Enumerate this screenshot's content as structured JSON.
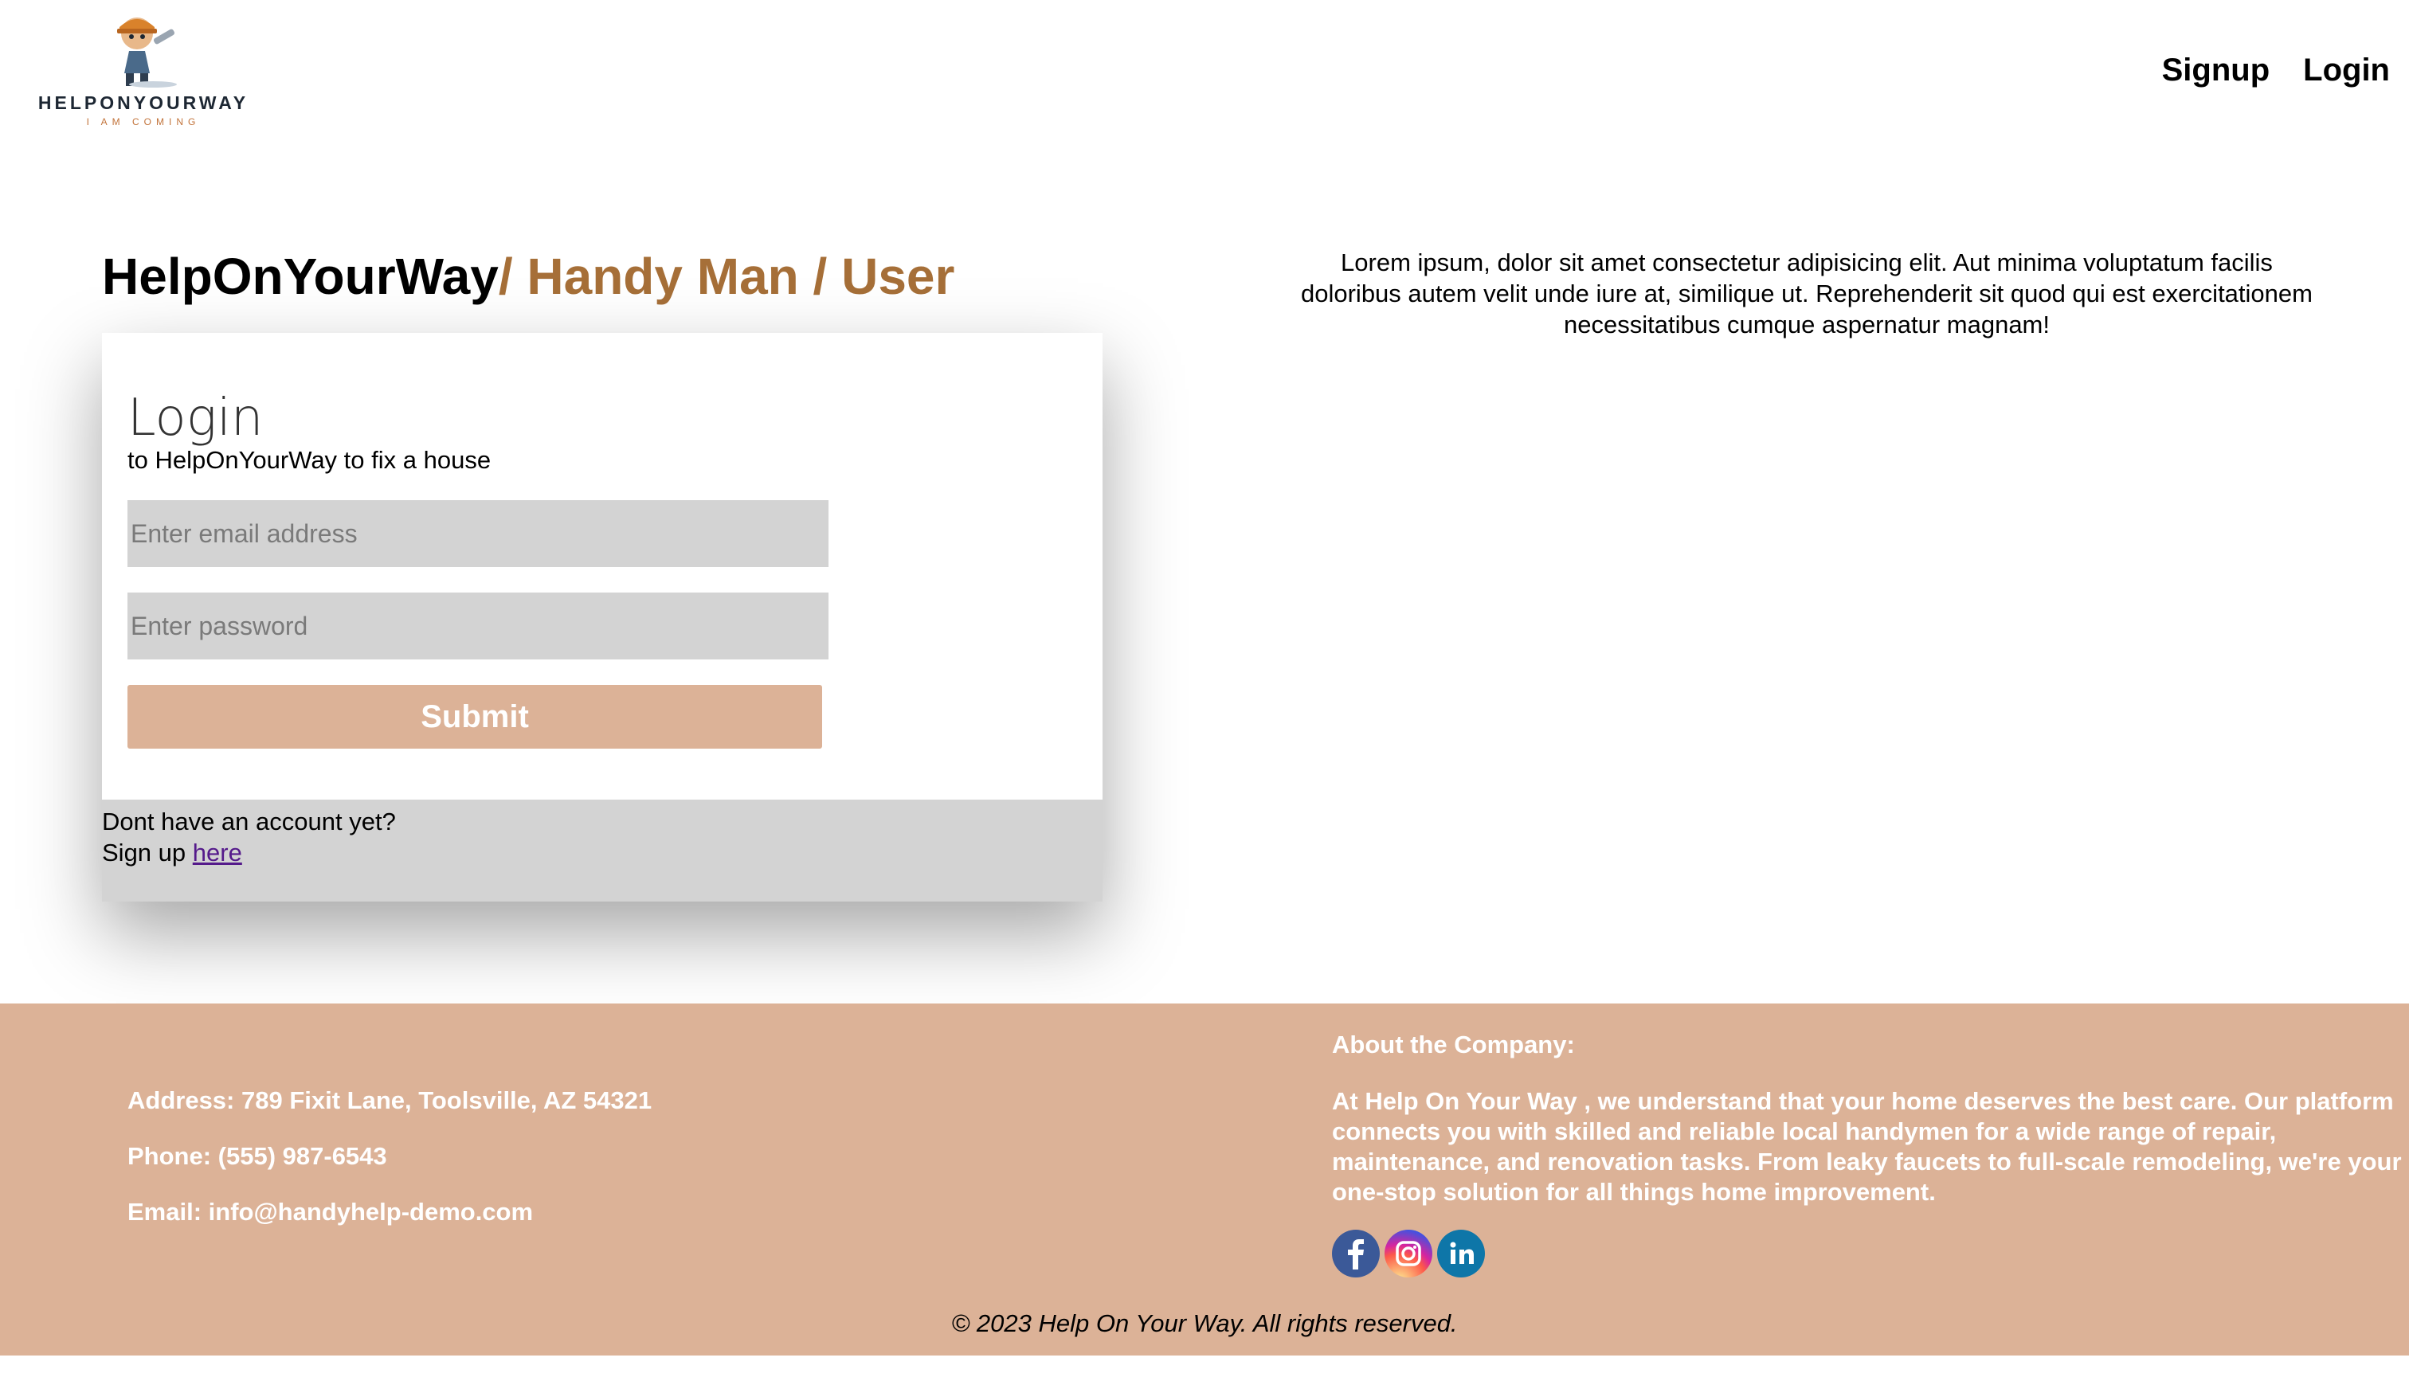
{
  "header": {
    "logo_name": "HELPONYOURWAY",
    "logo_tagline": "I AM COMING",
    "nav": {
      "signup": "Signup",
      "login": "Login"
    }
  },
  "breadcrumb": {
    "brand": "HelpOnYourWay",
    "path": "/ Handy Man / User"
  },
  "login_form": {
    "title": "Login",
    "subtitle": "to HelpOnYourWay to fix a house",
    "email_placeholder": "Enter email address",
    "password_placeholder": "Enter password",
    "submit_label": "Submit",
    "no_account_text": "Dont have an account yet?",
    "signup_prefix": "Sign up ",
    "signup_link": "here"
  },
  "intro_text": "Lorem ipsum, dolor sit amet consectetur adipisicing elit. Aut minima voluptatum facilis doloribus autem velit unde iure at, similique ut. Reprehenderit sit quod qui est exercitationem necessitatibus cumque aspernatur magnam!",
  "footer": {
    "address": "Address: 789 Fixit Lane, Toolsville, AZ 54321",
    "phone": "Phone: (555) 987-6543",
    "email": "Email: info@handyhelp-demo.com",
    "about_title": "About the Company:",
    "about_text": "At Help On Your Way , we understand that your home deserves the best care. Our platform connects you with skilled and reliable local handymen for a wide range of repair, maintenance, and renovation tasks. From leaky faucets to full-scale remodeling, we're your one-stop solution for all things home improvement.",
    "socials": [
      "facebook-icon",
      "instagram-icon",
      "linkedin-icon"
    ],
    "copyright": "© 2023 Help On Your Way. All rights reserved."
  },
  "colors": {
    "accent": "#a66f38",
    "footer_bg": "#dcb297",
    "input_bg": "#d3d3d3",
    "link": "#551a8b"
  }
}
